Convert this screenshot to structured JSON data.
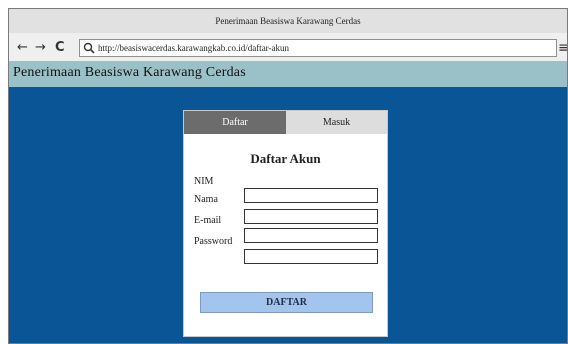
{
  "browser": {
    "window_title": "Penerimaan Beasiswa Karawang Cerdas",
    "url": "http://beasiswacerdas.karawangkab.co.id/daftar-akun",
    "back_icon": "←",
    "forward_icon": "→",
    "reload_icon": "C",
    "menu_icon": "≡"
  },
  "site": {
    "title": "Penerimaan Beasiswa Karawang Cerdas"
  },
  "card": {
    "tabs": [
      {
        "label": "Daftar",
        "active": true
      },
      {
        "label": "Masuk",
        "active": false
      }
    ],
    "form_title": "Daftar Akun",
    "fields": [
      {
        "label": "NIM",
        "value": ""
      },
      {
        "label": "Nama",
        "value": ""
      },
      {
        "label": "E-mail",
        "value": ""
      },
      {
        "label": "Password",
        "value": ""
      },
      {
        "label": "",
        "value": ""
      }
    ],
    "submit_label": "DAFTAR"
  },
  "colors": {
    "page_background": "#0a5595",
    "header_bar": "#9ac1c7",
    "active_tab": "#6c6c6c",
    "inactive_tab": "#dddddd",
    "submit_button": "#a3c4ec"
  }
}
